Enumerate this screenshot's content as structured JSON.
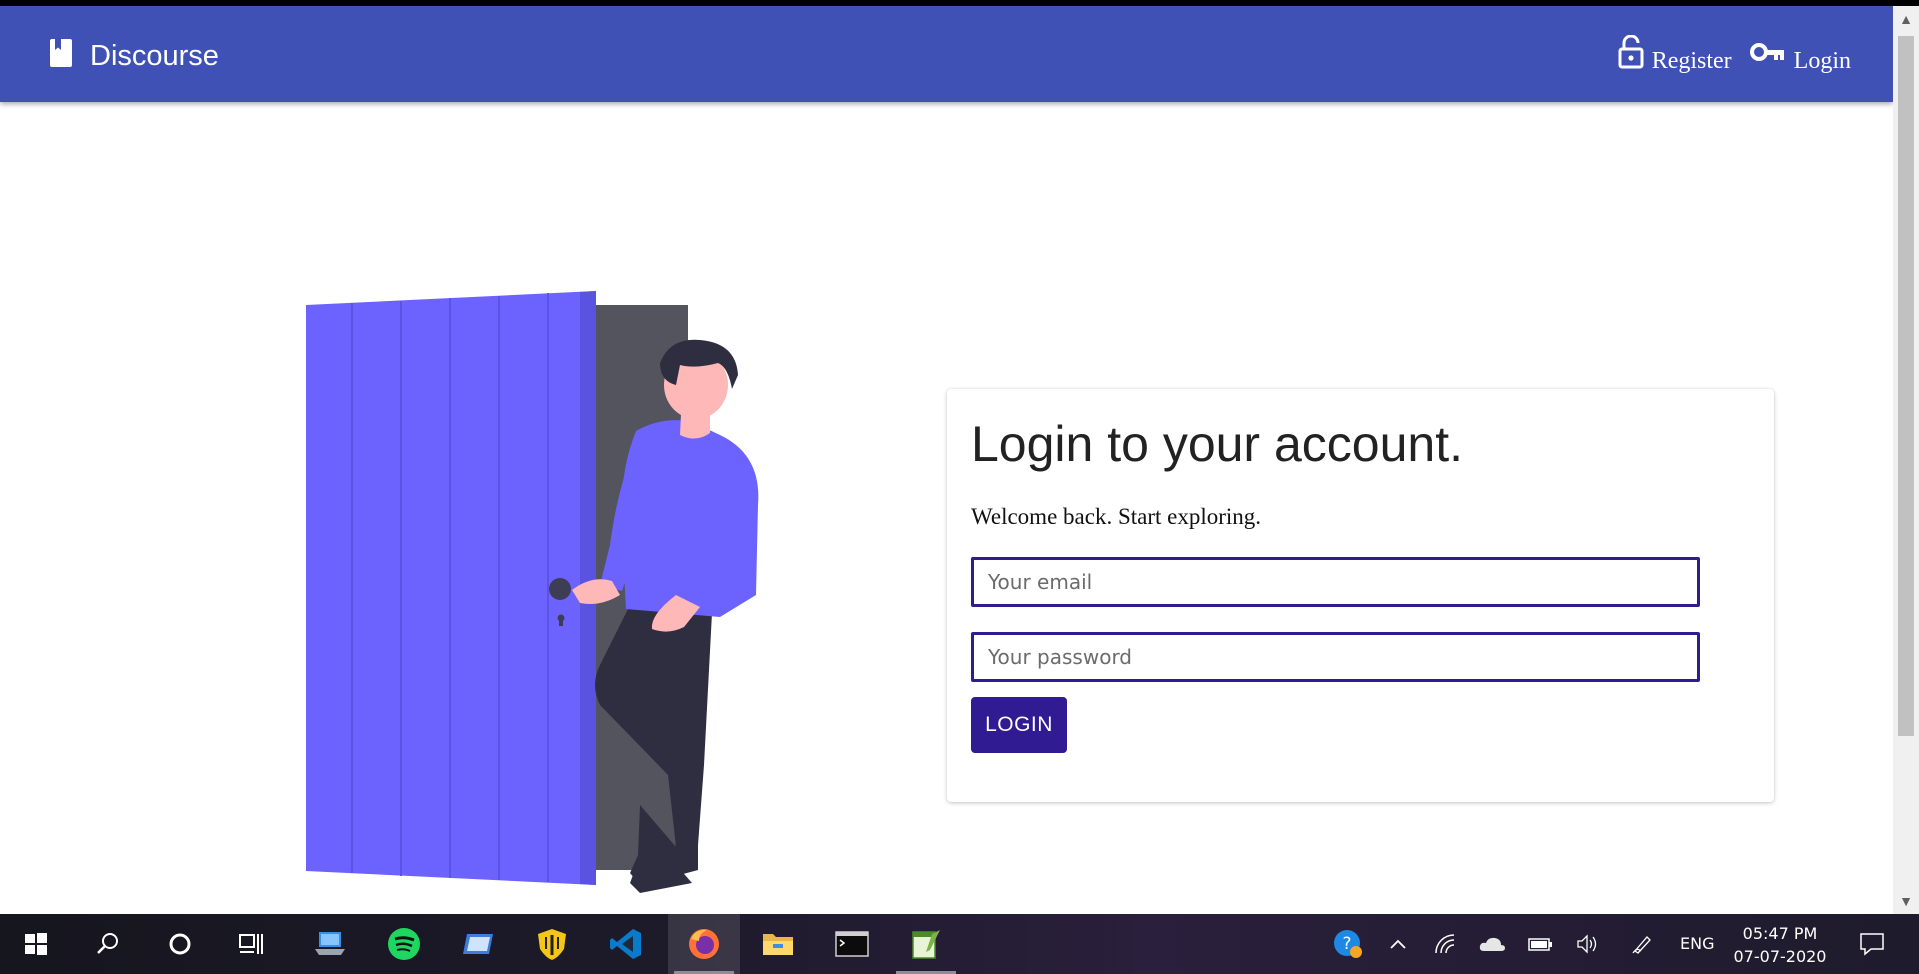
{
  "app": {
    "brand": "Discourse",
    "nav": {
      "register_label": "Register",
      "login_label": "Login"
    }
  },
  "login_card": {
    "title": "Login to your account.",
    "subtitle": "Welcome back. Start exploring.",
    "email_placeholder": "Your email",
    "password_placeholder": "Your password",
    "button_label": "LOGIN"
  },
  "taskbar": {
    "apps": [
      "windows-start-icon",
      "search-icon",
      "cortana-icon",
      "task-view-icon",
      "this-pc-icon",
      "spotify-icon",
      "news-app-icon",
      "security-app-icon",
      "vscode-icon",
      "firefox-icon",
      "file-explorer-icon",
      "terminal-icon",
      "notepad-icon"
    ],
    "active_app": "firefox-icon",
    "language": "ENG",
    "time": "05:47 PM",
    "date": "07-07-2020"
  },
  "colors": {
    "navbar": "#3f51b5",
    "accent": "#311b92",
    "door": "#6c63ff"
  }
}
